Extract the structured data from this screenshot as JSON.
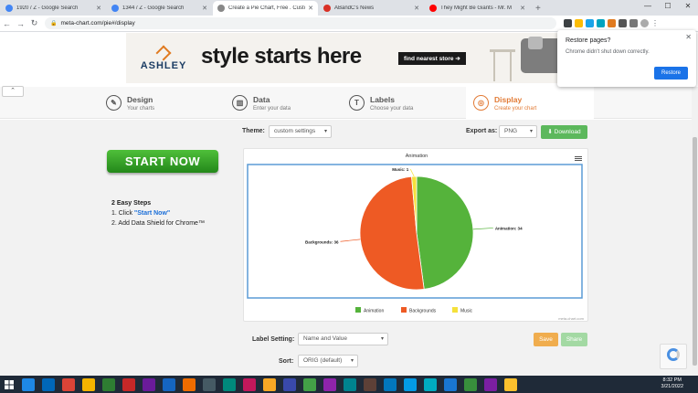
{
  "browser": {
    "tabs": [
      {
        "title": "1920 / Z - Google Search",
        "fav": "google-icon",
        "color": "#4285f4",
        "active": false
      },
      {
        "title": "1344 / Z - Google Search",
        "fav": "google-icon",
        "color": "#4285f4",
        "active": false
      },
      {
        "title": "Create a Pie Chart, Free . Custom",
        "fav": "meta-chart-icon",
        "color": "#888888",
        "active": true
      },
      {
        "title": "ABandC's News",
        "fav": "news-icon",
        "color": "#d93025",
        "active": false
      },
      {
        "title": "They Might Be Giants - Mr. M",
        "fav": "youtube-icon",
        "color": "#ff0000",
        "active": false
      }
    ],
    "new_tab": "+",
    "url": "meta-chart.com/pie#/display",
    "window_controls": [
      "—",
      "☐",
      "✕"
    ]
  },
  "ad": {
    "brand": "ASHLEY",
    "headline": "style starts here",
    "cta": "find nearest store ➔"
  },
  "restore_popup": {
    "title": "Restore pages?",
    "body": "Chrome didn't shut down correctly.",
    "button": "Restore",
    "close": "✕"
  },
  "steps": [
    {
      "title": "Design",
      "subtitle": "Your charts",
      "icon": "palette-icon",
      "glyph": "✎"
    },
    {
      "title": "Data",
      "subtitle": "Enter your data",
      "icon": "bar-chart-icon",
      "glyph": "▥"
    },
    {
      "title": "Labels",
      "subtitle": "Choose your data",
      "icon": "text-icon",
      "glyph": "T"
    },
    {
      "title": "Display",
      "subtitle": "Create your chart",
      "icon": "display-icon",
      "glyph": "◎"
    }
  ],
  "collapse": "⌃",
  "sidebar": {
    "start_now": "START NOW",
    "easy_title": "2 Easy Steps",
    "step1_prefix": "1. Click ",
    "step1_link": "\"Start Now\"",
    "step2": "2. Add Data Shield for Chrome™"
  },
  "controls": {
    "theme_label": "Theme:",
    "theme_value": "custom settings",
    "export_label": "Export as:",
    "export_value": "PNG",
    "download": "⬇ Download",
    "label_setting_label": "Label Setting:",
    "label_setting_value": "Name and Value",
    "sort_label": "Sort:",
    "sort_value": "ORIG (default)",
    "save": "Save",
    "share": "Share"
  },
  "chart_data": {
    "type": "pie",
    "title": "Animation",
    "categories": [
      "Animation",
      "Backgrounds",
      "Music"
    ],
    "values": [
      34,
      36,
      1
    ],
    "colors": [
      "#55b33b",
      "#ee5a24",
      "#f5e13b"
    ],
    "data_labels": [
      "Animation: 34",
      "Backgrounds: 36",
      "Music: 1"
    ],
    "legend_position": "bottom",
    "credit": "meta-chart.com",
    "menu_icon": "hamburger-icon"
  },
  "taskbar": {
    "clock_time": "8:32 PM",
    "clock_date": "3/21/2022",
    "icons": [
      "#1e88e5",
      "#0067b8",
      "#db4437",
      "#f4b400",
      "#2e7d32",
      "#c62828",
      "#6a1b9a",
      "#1565c0",
      "#ef6c00",
      "#455a64",
      "#00897b",
      "#c2185b",
      "#f9a825",
      "#3949ab",
      "#43a047",
      "#8e24aa",
      "#00838f",
      "#5d4037",
      "#0277bd",
      "#039be5",
      "#00acc1",
      "#1976d2",
      "#388e3c",
      "#7b1fa2",
      "#fbc02d"
    ]
  }
}
